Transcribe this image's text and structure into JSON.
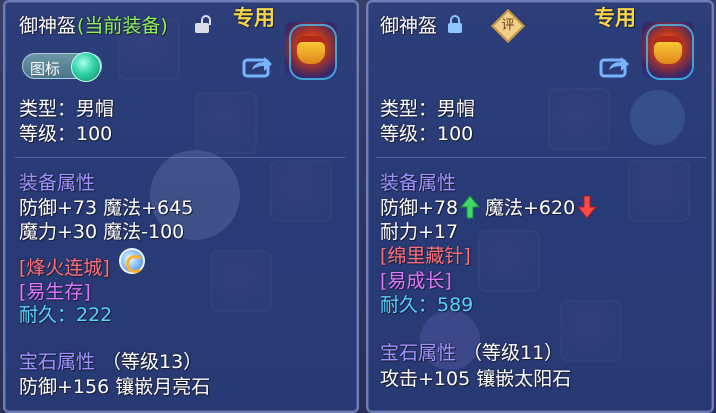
{
  "left": {
    "name": "御神盔",
    "status": "(当前装备)",
    "exclusive": "专用",
    "toggle_label": "图标",
    "type_line": "类型：男帽",
    "level_line": "等级：100",
    "attr_header": "装备属性",
    "attr_lines": [
      "防御+73 魔法+645",
      "魔力+30 魔法-100"
    ],
    "special_skill": "[烽火连城]",
    "special_effect": "[易生存]",
    "durability": "耐久：222",
    "gem_header": "宝石属性",
    "gem_level": "（等级13）",
    "gem_line": "防御+156 镶嵌月亮石"
  },
  "right": {
    "name": "御神盔",
    "exclusive": "专用",
    "rate_badge": "评",
    "type_line": "类型：男帽",
    "level_line": "等级：100",
    "attr_header": "装备属性",
    "attr_line1_a": "防御+78",
    "attr_line1_b": "魔法+620",
    "attr_line2": "耐力+17",
    "special_skill": "[绵里藏针]",
    "special_effect": "[易成长]",
    "durability": "耐久：589",
    "gem_header": "宝石属性",
    "gem_level": "（等级11）",
    "gem_line": "攻击+105 镶嵌太阳石"
  },
  "icons": {
    "unlock": "unlock-icon",
    "lock": "lock-icon",
    "share": "share-icon",
    "up": "arrow-up-icon",
    "down": "arrow-down-icon"
  },
  "colors": {
    "name": "#ffffff",
    "status": "#8ff25c",
    "exclusive": "#f5d54a",
    "header": "#9f93ff",
    "skill": "#ff6f78",
    "effect": "#e176ff",
    "durability": "#56d2ff"
  }
}
